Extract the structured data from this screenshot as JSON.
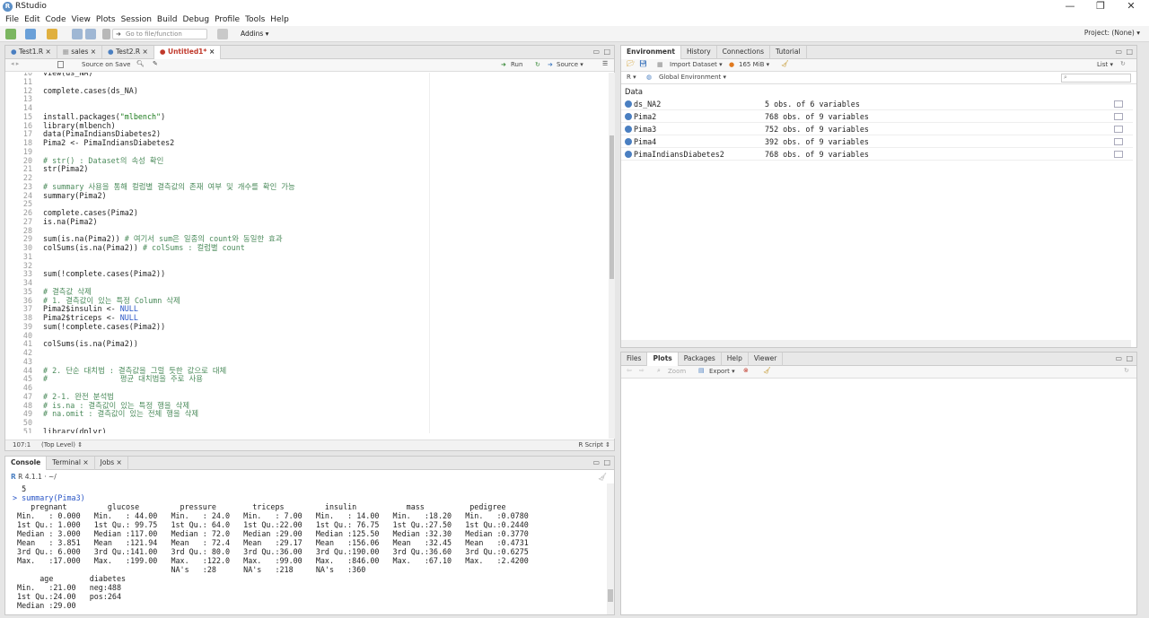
{
  "window": {
    "title": "RStudio",
    "logo_letter": "R"
  },
  "menu": [
    "File",
    "Edit",
    "Code",
    "View",
    "Plots",
    "Session",
    "Build",
    "Debug",
    "Profile",
    "Tools",
    "Help"
  ],
  "toolbar": {
    "goto_placeholder": "Go to file/function",
    "addins": "Addins ▾",
    "project": "Project: (None) ▾"
  },
  "editor": {
    "tabs": [
      "Test1.R",
      "sales",
      "Test2.R",
      "Untitled1*"
    ],
    "active_tab": 3,
    "source_on_save": "Source on Save",
    "run_label": "Run",
    "source_label": "Source ▾",
    "cursor_pos": "107:1",
    "scope": "(Top Level) ⇕",
    "filetype": "R Script ⇕",
    "lines": [
      {
        "n": "10",
        "html": "<span>View(ds_NA)</span>"
      },
      {
        "n": "11",
        "html": ""
      },
      {
        "n": "12",
        "html": "complete.cases(ds_NA)"
      },
      {
        "n": "13",
        "html": ""
      },
      {
        "n": "14",
        "html": ""
      },
      {
        "n": "15",
        "html": "install.packages(<span class=\"st\">\"mlbench\"</span>)"
      },
      {
        "n": "16",
        "html": "library(mlbench)"
      },
      {
        "n": "17",
        "html": "data(PimaIndiansDiabetes2)"
      },
      {
        "n": "18",
        "html": "Pima2 &lt;- PimaIndiansDiabetes2"
      },
      {
        "n": "19",
        "html": ""
      },
      {
        "n": "20",
        "html": "<span class=\"cm\"># str() : Dataset의 속성 확인</span>"
      },
      {
        "n": "21",
        "html": "str(Pima2)"
      },
      {
        "n": "22",
        "html": ""
      },
      {
        "n": "23",
        "html": "<span class=\"cm\"># summary 사용을 통해 컬럼별 결측값의 존재 여부 및 개수를 확인 가능</span>"
      },
      {
        "n": "24",
        "html": "summary(Pima2)"
      },
      {
        "n": "25",
        "html": ""
      },
      {
        "n": "26",
        "html": "complete.cases(Pima2)"
      },
      {
        "n": "27",
        "html": "is.na(Pima2)"
      },
      {
        "n": "28",
        "html": ""
      },
      {
        "n": "29",
        "html": "sum(is.na(Pima2)) <span class=\"cm\"># 여기서 sum은 일종의 count와 동일한 효과</span>"
      },
      {
        "n": "30",
        "html": "colSums(is.na(Pima2)) <span class=\"cm\"># colSums : 컬럼별 count</span>"
      },
      {
        "n": "31",
        "html": ""
      },
      {
        "n": "32",
        "html": ""
      },
      {
        "n": "33",
        "html": "sum(!complete.cases(Pima2))"
      },
      {
        "n": "34",
        "html": ""
      },
      {
        "n": "35",
        "html": "<span class=\"cm\"># 결측값 삭제</span>"
      },
      {
        "n": "36",
        "html": "<span class=\"cm\"># 1. 결측값이 있는 특정 Column 삭제</span>"
      },
      {
        "n": "37",
        "html": "Pima2$insulin &lt;- <span class=\"kw\">NULL</span>"
      },
      {
        "n": "38",
        "html": "Pima2$triceps &lt;- <span class=\"kw\">NULL</span>"
      },
      {
        "n": "39",
        "html": "sum(!complete.cases(Pima2))"
      },
      {
        "n": "40",
        "html": ""
      },
      {
        "n": "41",
        "html": "colSums(is.na(Pima2))"
      },
      {
        "n": "42",
        "html": ""
      },
      {
        "n": "43",
        "html": ""
      },
      {
        "n": "44",
        "html": "<span class=\"cm\"># 2. 단순 대치법 : 결측값을 그럴 듯한 값으로 대체</span>"
      },
      {
        "n": "45",
        "html": "<span class=\"cm\">#                평균 대치법을 주로 사용</span>"
      },
      {
        "n": "46",
        "html": ""
      },
      {
        "n": "47",
        "html": "<span class=\"cm\"># 2-1. 완전 분석법</span>"
      },
      {
        "n": "48",
        "html": "<span class=\"cm\"># is.na : 결측값이 있는 특정 행을 삭제</span>"
      },
      {
        "n": "49",
        "html": "<span class=\"cm\"># na.omit : 결측값이 있는 전체 행을 삭제</span>"
      },
      {
        "n": "50",
        "html": ""
      },
      {
        "n": "51",
        "html": "library(dplyr)"
      }
    ]
  },
  "console": {
    "tabs": [
      "Console",
      "Terminal",
      "Jobs"
    ],
    "version": "R 4.1.1 · ~/",
    "lines": [
      "  5",
      "> summary(Pima3)",
      "    pregnant         glucose         pressure        triceps         insulin           mass          pedigree     ",
      " Min.   : 0.000   Min.   : 44.00   Min.   : 24.0   Min.   : 7.00   Min.   : 14.00   Min.   :18.20   Min.   :0.0780  ",
      " 1st Qu.: 1.000   1st Qu.: 99.75   1st Qu.: 64.0   1st Qu.:22.00   1st Qu.: 76.75   1st Qu.:27.50   1st Qu.:0.2440  ",
      " Median : 3.000   Median :117.00   Median : 72.0   Median :29.00   Median :125.50   Median :32.30   Median :0.3770  ",
      " Mean   : 3.851   Mean   :121.94   Mean   : 72.4   Mean   :29.17   Mean   :156.06   Mean   :32.45   Mean   :0.4731  ",
      " 3rd Qu.: 6.000   3rd Qu.:141.00   3rd Qu.: 80.0   3rd Qu.:36.00   3rd Qu.:190.00   3rd Qu.:36.60   3rd Qu.:0.6275  ",
      " Max.   :17.000   Max.   :199.00   Max.   :122.0   Max.   :99.00   Max.   :846.00   Max.   :67.10   Max.   :2.4200  ",
      "                                   NA's   :28      NA's   :218     NA's   :360                                    ",
      "      age        diabetes ",
      " Min.   :21.00   neg:488  ",
      " 1st Qu.:24.00   pos:264  ",
      " Median :29.00            "
    ]
  },
  "environment": {
    "tabs": [
      "Environment",
      "History",
      "Connections",
      "Tutorial"
    ],
    "import": "Import Dataset ▾",
    "memory": "165 MiB ▾",
    "list": "List ▾",
    "lang": "R ▾",
    "scope": "Global Environment ▾",
    "section": "Data",
    "rows": [
      {
        "name": "ds_NA2",
        "desc": "5 obs. of 6 variables"
      },
      {
        "name": "Pima2",
        "desc": "768 obs. of 9 variables"
      },
      {
        "name": "Pima3",
        "desc": "752 obs. of 9 variables"
      },
      {
        "name": "Pima4",
        "desc": "392 obs. of 9 variables"
      },
      {
        "name": "PimaIndiansDiabetes2",
        "desc": "768 obs. of 9 variables"
      }
    ]
  },
  "files": {
    "tabs": [
      "Files",
      "Plots",
      "Packages",
      "Help",
      "Viewer"
    ],
    "zoom": "Zoom",
    "export": "Export ▾"
  }
}
